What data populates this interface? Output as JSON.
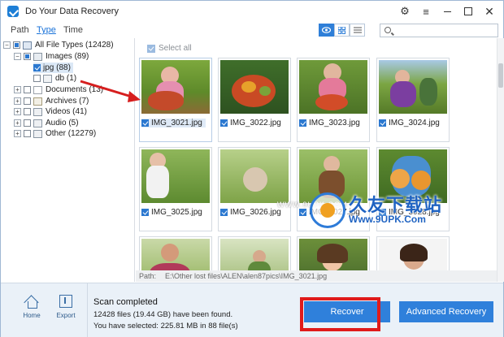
{
  "app": {
    "title": "Do Your Data Recovery"
  },
  "nav_tabs": [
    {
      "label": "Path"
    },
    {
      "label": "Type"
    },
    {
      "label": "Time"
    }
  ],
  "active_tab": "Type",
  "search": {
    "value": "",
    "placeholder": ""
  },
  "tree": {
    "items": [
      {
        "label": "All File Types (12428)",
        "icon": "computer-icon",
        "state": "partial"
      },
      {
        "label": "Images (89)",
        "icon": "image-folder-icon",
        "state": "partial"
      },
      {
        "label": "jpg (88)",
        "icon": "",
        "state": "checked"
      },
      {
        "label": "db (1)",
        "icon": "file-icon",
        "state": "unchecked"
      },
      {
        "label": "Documents (13)",
        "icon": "document-icon",
        "state": "unchecked"
      },
      {
        "label": "Archives (7)",
        "icon": "archive-icon",
        "state": "unchecked"
      },
      {
        "label": "Videos (41)",
        "icon": "video-icon",
        "state": "unchecked"
      },
      {
        "label": "Audio (5)",
        "icon": "audio-icon",
        "state": "unchecked"
      },
      {
        "label": "Other (12279)",
        "icon": "other-icon",
        "state": "unchecked"
      }
    ]
  },
  "grid": {
    "select_all_label": "Select all",
    "thumbnails": [
      {
        "label": "IMG_3021.jpg",
        "checked": true
      },
      {
        "label": "IMG_3022.jpg",
        "checked": true
      },
      {
        "label": "IMG_3023.jpg",
        "checked": true
      },
      {
        "label": "IMG_3024.jpg",
        "checked": true
      },
      {
        "label": "IMG_3025.jpg",
        "checked": true
      },
      {
        "label": "IMG_3026.jpg",
        "checked": true
      },
      {
        "label": "IMG_3027.jpg",
        "checked": true
      },
      {
        "label": "IMG_3028.jpg",
        "checked": true
      },
      {
        "label": "",
        "checked": true
      },
      {
        "label": "",
        "checked": true
      },
      {
        "label": "",
        "checked": true
      },
      {
        "label": "",
        "checked": true
      }
    ]
  },
  "path_bar": {
    "label": "Path:",
    "value": "E:\\Other lost files\\ALEN\\alen87pics\\IMG_3021.jpg"
  },
  "bottom": {
    "home_label": "Home",
    "export_label": "Export",
    "status_title": "Scan completed",
    "status_found": "12428 files (19.44 GB) have been found.",
    "status_selected": "You have selected: 225.81 MB in 88 file(s)",
    "recover_label": "Recover",
    "advanced_label": "Advanced Recovery"
  },
  "watermark": {
    "text": "久友下载站",
    "url": "Www.9UPK.Com",
    "left_text": "WWW.9UPK.COM"
  },
  "colors": {
    "accent": "#2f80db",
    "highlight_border": "#e01b1b",
    "arrow": "#d61e1e"
  }
}
